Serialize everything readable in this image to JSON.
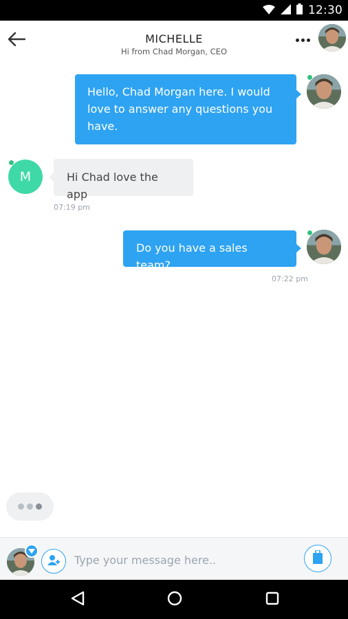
{
  "status_bar": {
    "time": "12:30",
    "icons": [
      "wifi-icon",
      "signal-icon",
      "battery-icon"
    ]
  },
  "header": {
    "title": "MICHELLE",
    "subtitle": "Hi from Chad Morgan, CEO",
    "back_icon": "arrow-left-icon",
    "more_icon": "more-horizontal-icon"
  },
  "messages": [
    {
      "direction": "outgoing",
      "text": "Hello, Chad Morgan here. I would love to answer any questions you have.",
      "time": ""
    },
    {
      "direction": "incoming",
      "sender_initial": "M",
      "text": "Hi Chad love the app",
      "time": "07:19 pm"
    },
    {
      "direction": "outgoing",
      "text": "Do you have a sales team?",
      "time": "07:22 pm"
    }
  ],
  "typing_indicator": {
    "dots": 3
  },
  "input_bar": {
    "placeholder": "Type your message here..",
    "value": "",
    "add_user_icon": "add-user-icon",
    "attach_icon": "attachment-icon"
  },
  "nav_bar": {
    "icons": [
      "back-triangle-icon",
      "home-circle-icon",
      "recents-square-icon"
    ]
  },
  "colors": {
    "accent": "#2ea3f2",
    "incoming_bubble": "#eef0f2",
    "letter_avatar": "#3fd9a7",
    "online": "#2ec27e"
  }
}
